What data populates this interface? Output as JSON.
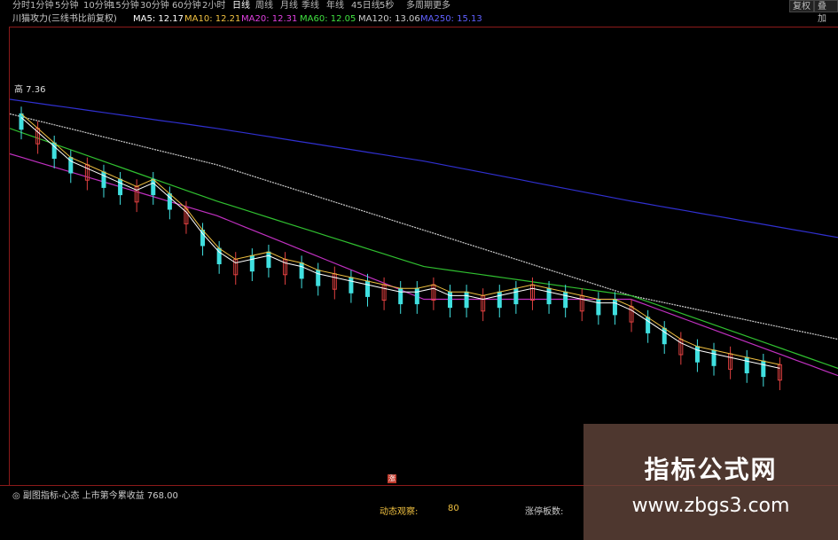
{
  "toolbar": {
    "periods": [
      "分时",
      "1分钟",
      "5分钟",
      "10分钟",
      "15分钟",
      "30分钟",
      "60分钟",
      "2小时",
      "日线",
      "周线",
      "月线",
      "季线",
      "年线",
      "45日线",
      "5秒",
      "多周期",
      "更多"
    ],
    "active_period": "日线",
    "back_label": "复权",
    "overlay_label": "叠加"
  },
  "ma_bar": {
    "indicator_name": "川猫攻力(三线书比前复权)",
    "ma5": "MA5: 12.17",
    "ma10": "MA10: 12.21",
    "ma20": "MA20: 12.31",
    "ma60": "MA60: 12.05",
    "ma120": "MA120: 13.06",
    "ma250": "MA250: 15.13",
    "colors": {
      "ma5": "#ffffff",
      "ma10": "#f0c040",
      "ma20": "#e040e0",
      "ma60": "#40e040",
      "ma120": "#cccccc",
      "ma250": "#4040ff"
    }
  },
  "chart": {
    "high_label": "高 7.36",
    "marker_label": "涨"
  },
  "chart_data": {
    "type": "candlestick",
    "series_note": "values as fractional price levels (0 = bottom of main panel, 1 = top)",
    "ma250": [
      0.9,
      0.82,
      0.73,
      0.62,
      0.52
    ],
    "ma120": [
      0.86,
      0.72,
      0.54,
      0.36,
      0.24
    ],
    "ma60": [
      0.82,
      0.62,
      0.44,
      0.36,
      0.16
    ],
    "ma20": [
      0.75,
      0.58,
      0.35,
      0.35,
      0.14
    ],
    "candles": [
      0.84,
      0.8,
      0.76,
      0.72,
      0.7,
      0.68,
      0.66,
      0.64,
      0.66,
      0.62,
      0.58,
      0.52,
      0.47,
      0.44,
      0.45,
      0.46,
      0.44,
      0.43,
      0.41,
      0.4,
      0.39,
      0.38,
      0.37,
      0.36,
      0.36,
      0.37,
      0.35,
      0.35,
      0.34,
      0.35,
      0.36,
      0.37,
      0.36,
      0.35,
      0.34,
      0.33,
      0.33,
      0.31,
      0.28,
      0.25,
      0.22,
      0.2,
      0.19,
      0.18,
      0.17,
      0.16,
      0.15
    ]
  },
  "bottom": {
    "subtitle": "◎ 副图指标-心态 上市第今累收益  768.00",
    "label1": "动态观察:",
    "value1": "80",
    "label2": "涨停板数:"
  },
  "watermark": {
    "title": "指标公式网",
    "url": "www.zbgs3.com"
  }
}
